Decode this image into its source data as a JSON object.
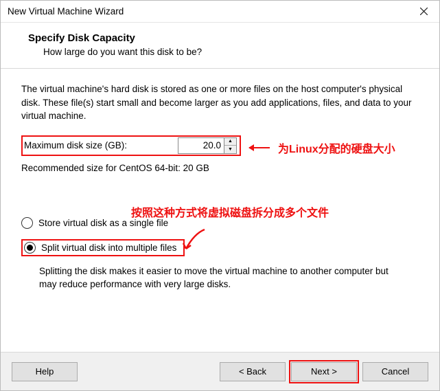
{
  "window": {
    "title": "New Virtual Machine Wizard"
  },
  "header": {
    "title": "Specify Disk Capacity",
    "subtitle": "How large do you want this disk to be?"
  },
  "main": {
    "description": "The virtual machine's hard disk is stored as one or more files on the host computer's physical disk. These file(s) start small and become larger as you add applications, files, and data to your virtual machine.",
    "max_size_label": "Maximum disk size (GB):",
    "max_size_value": "20.0",
    "recommended": "Recommended size for CentOS 64-bit: 20 GB",
    "radio_single": "Store virtual disk as a single file",
    "radio_split": "Split virtual disk into multiple files",
    "selected": "split",
    "split_desc": "Splitting the disk makes it easier to move the virtual machine to another computer but may reduce performance with very large disks."
  },
  "annotations": {
    "size": "为Linux分配的硬盘大小",
    "split": "按照这种方式将虚拟磁盘拆分成多个文件"
  },
  "buttons": {
    "help": "Help",
    "back": "< Back",
    "next": "Next >",
    "cancel": "Cancel"
  }
}
